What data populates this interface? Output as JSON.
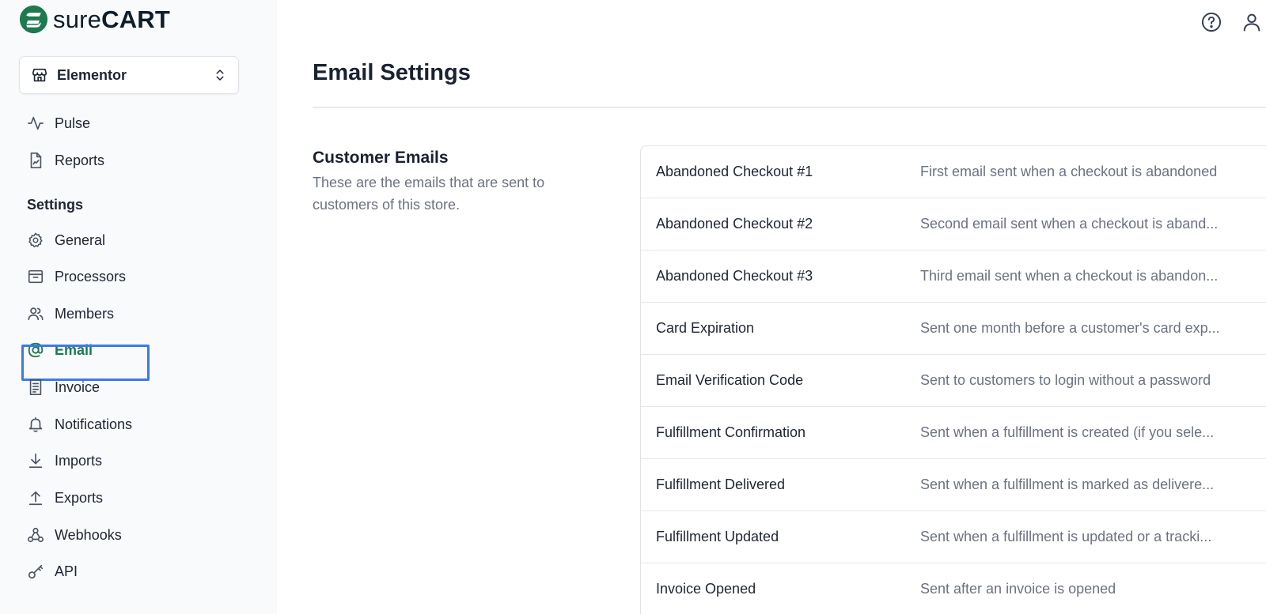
{
  "brand": {
    "name_light": "sure",
    "name_bold": "CART",
    "color": "#1d7a4f"
  },
  "store": {
    "label": "Elementor"
  },
  "nav_top": [
    {
      "label": "Pulse",
      "icon": "pulse-icon"
    },
    {
      "label": "Reports",
      "icon": "reports-icon"
    }
  ],
  "settings_heading": "Settings",
  "nav_settings": [
    {
      "label": "General",
      "icon": "gear-icon"
    },
    {
      "label": "Processors",
      "icon": "processors-icon"
    },
    {
      "label": "Members",
      "icon": "members-icon"
    },
    {
      "label": "Email",
      "icon": "at-icon",
      "active": true
    },
    {
      "label": "Invoice",
      "icon": "invoice-icon"
    },
    {
      "label": "Notifications",
      "icon": "bell-icon"
    },
    {
      "label": "Imports",
      "icon": "import-icon"
    },
    {
      "label": "Exports",
      "icon": "export-icon"
    },
    {
      "label": "Webhooks",
      "icon": "webhooks-icon"
    },
    {
      "label": "API",
      "icon": "key-icon"
    }
  ],
  "header_icons": [
    "help-icon",
    "user-icon"
  ],
  "page": {
    "title": "Email Settings",
    "section_title": "Customer Emails",
    "section_desc": "These are the emails that are sent to customers of this store."
  },
  "emails": [
    {
      "name": "Abandoned Checkout #1",
      "desc": "First email sent when a checkout is abandoned"
    },
    {
      "name": "Abandoned Checkout #2",
      "desc": "Second email sent when a checkout is aband..."
    },
    {
      "name": "Abandoned Checkout #3",
      "desc": "Third email sent when a checkout is abandon..."
    },
    {
      "name": "Card Expiration",
      "desc": "Sent one month before a customer's card exp..."
    },
    {
      "name": "Email Verification Code",
      "desc": "Sent to customers to login without a password"
    },
    {
      "name": "Fulfillment Confirmation",
      "desc": "Sent when a fulfillment is created (if you sele..."
    },
    {
      "name": "Fulfillment Delivered",
      "desc": "Sent when a fulfillment is marked as delivere..."
    },
    {
      "name": "Fulfillment Updated",
      "desc": "Sent when a fulfillment is updated or a tracki..."
    },
    {
      "name": "Invoice Opened",
      "desc": "Sent after an invoice is opened"
    }
  ]
}
